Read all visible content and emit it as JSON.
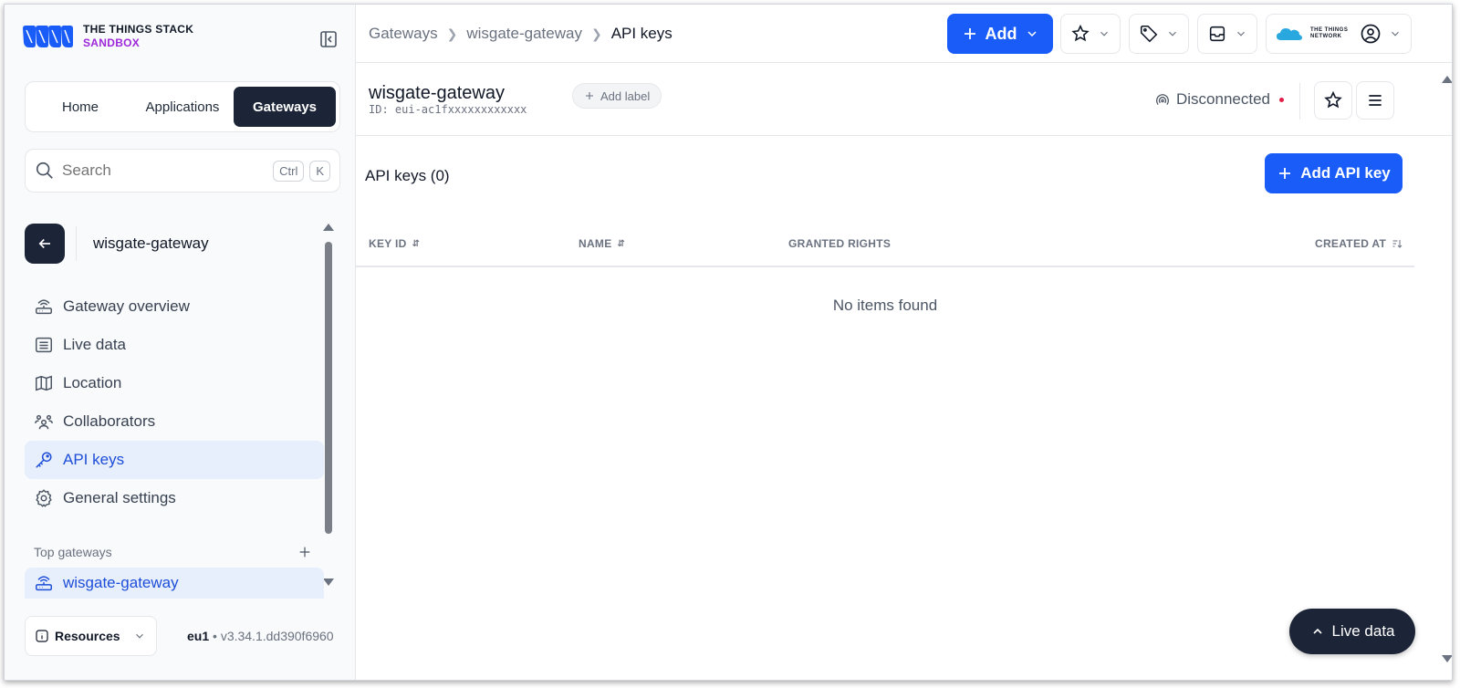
{
  "brand": {
    "line1": "THE THINGS STACK",
    "line2": "SANDBOX"
  },
  "tabs": [
    {
      "label": "Home"
    },
    {
      "label": "Applications"
    },
    {
      "label": "Gateways",
      "active": true
    }
  ],
  "search": {
    "placeholder": "Search",
    "kbd1": "Ctrl",
    "kbd2": "K"
  },
  "entity": {
    "title": "wisgate-gateway"
  },
  "nav": [
    {
      "label": "Gateway overview",
      "icon": "gateway-icon"
    },
    {
      "label": "Live data",
      "icon": "list-icon"
    },
    {
      "label": "Location",
      "icon": "map-icon"
    },
    {
      "label": "Collaborators",
      "icon": "people-icon"
    },
    {
      "label": "API keys",
      "icon": "key-icon",
      "active": true
    },
    {
      "label": "General settings",
      "icon": "gear-icon"
    }
  ],
  "top_gateways": {
    "heading": "Top gateways",
    "items": [
      {
        "label": "wisgate-gateway"
      }
    ]
  },
  "footer": {
    "resources": "Resources",
    "region": "eu1",
    "version": "v3.34.1.dd390f6960"
  },
  "breadcrumbs": [
    "Gateways",
    "wisgate-gateway",
    "API keys"
  ],
  "header": {
    "add_label": "Add",
    "ttn_logo": "THE THINGS NETWORK"
  },
  "gateway": {
    "name": "wisgate-gateway",
    "id": "ID: eui-ac1fxxxxxxxxxxxx",
    "add_label": "Add label",
    "status": "Disconnected"
  },
  "api_keys": {
    "title": "API keys (0)",
    "add_button": "Add API key",
    "columns": [
      "KEY ID",
      "NAME",
      "GRANTED RIGHTS",
      "CREATED AT"
    ],
    "empty": "No items found"
  },
  "live_data_button": "Live data",
  "colors": {
    "primary": "#1a5cf7",
    "dark": "#1c2537",
    "sandbox": "#9d28d9",
    "active_bg": "#e8effc",
    "status_red": "#e11d48"
  }
}
